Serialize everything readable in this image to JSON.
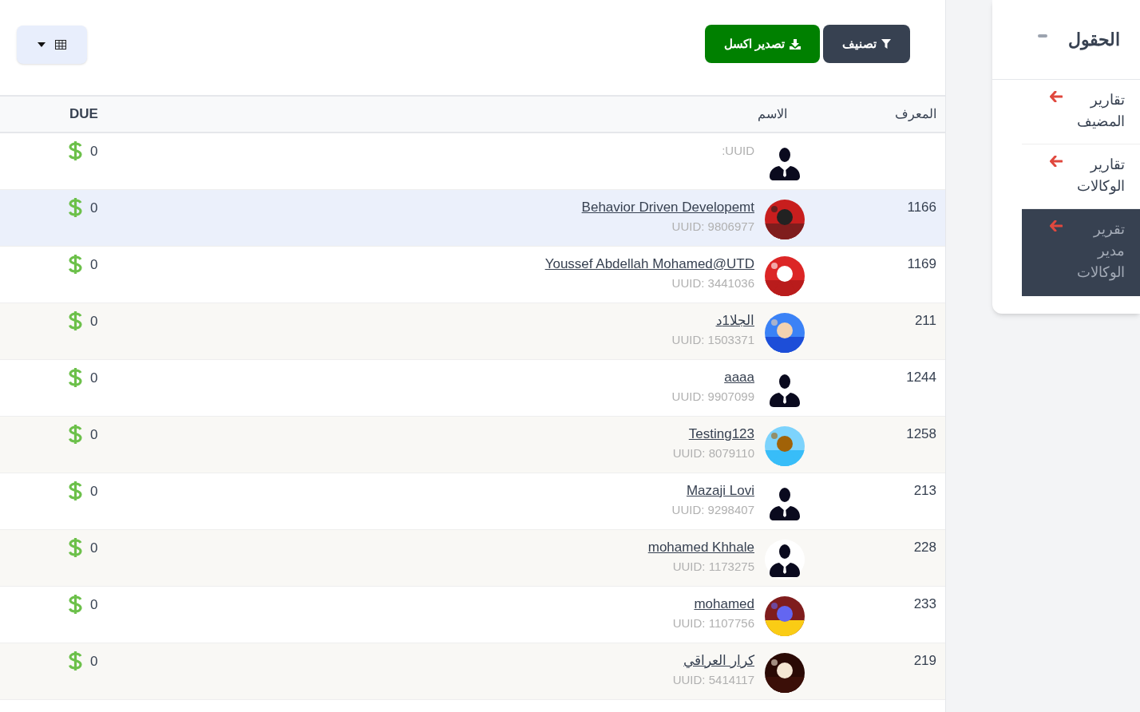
{
  "toolbar": {
    "buttons": [
      {
        "kind": "filter",
        "label": "تصنيف"
      },
      {
        "kind": "export",
        "label": "تصدير اكسل"
      }
    ]
  },
  "table": {
    "columns": [
      "المعرف",
      "الاسم",
      "DUE"
    ],
    "rows": [
      {
        "id": "",
        "name": "",
        "uuid": ":UUID",
        "avatar": {
          "kind": "silhouette"
        },
        "due": "0",
        "selected": false
      },
      {
        "id": "1166",
        "name": "Behavior Driven Developemt",
        "uuid": "UUID: 9806977",
        "due": "0",
        "selected": true
      },
      {
        "id": "1169",
        "name": "Youssef Abdellah Mohamed@UTD",
        "uuid": "UUID: 3441036",
        "due": "0",
        "selected": false
      },
      {
        "id": "211",
        "name": "الجلا1د",
        "uuid": "UUID: 1503371",
        "due": "0",
        "selected": false
      },
      {
        "id": "1244",
        "name": "aaaa",
        "uuid": "UUID: 9907099",
        "avatar": {
          "kind": "silhouette"
        },
        "due": "0",
        "selected": false
      },
      {
        "id": "1258",
        "name": "Testing123",
        "uuid": "UUID: 8079110",
        "due": "0",
        "selected": false
      },
      {
        "id": "213",
        "name": "Mazaji Lovi",
        "uuid": "UUID: 9298407",
        "avatar": {
          "kind": "silhouette"
        },
        "due": "0",
        "selected": false
      },
      {
        "id": "228",
        "name": "mohamed Khhale",
        "uuid": "UUID: 1173275",
        "avatar": {
          "kind": "silhouette"
        },
        "due": "0",
        "selected": false
      },
      {
        "id": "233",
        "name": "mohamed",
        "uuid": "UUID: 1107756",
        "due": "0",
        "selected": false
      },
      {
        "id": "219",
        "name": "كرار العراقي",
        "uuid": "UUID: 5414117",
        "due": "0",
        "selected": false
      }
    ]
  },
  "sidebar": {
    "title": "الحقول",
    "items": [
      {
        "label": "تقارير المضيف",
        "selected": false
      },
      {
        "label": "تقارير الوكالات",
        "selected": false
      },
      {
        "label": "تقرير مدير الوكالات",
        "selected": true
      }
    ]
  }
}
